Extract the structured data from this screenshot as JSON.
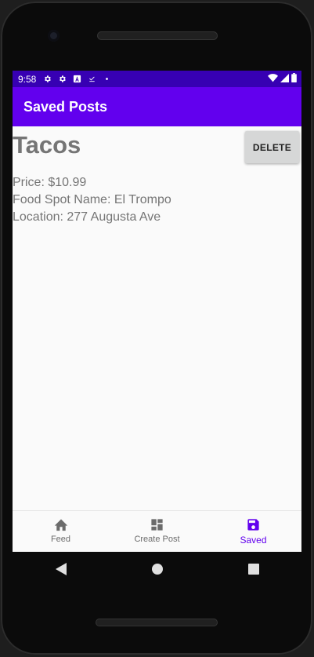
{
  "status": {
    "time": "9:58",
    "icons": [
      "gear-icon",
      "gear-icon",
      "a-icon",
      "download-done-icon",
      "dot-icon"
    ],
    "right_icons": [
      "wifi-icon",
      "signal-icon",
      "battery-icon"
    ]
  },
  "appbar": {
    "title": "Saved Posts"
  },
  "post": {
    "title": "Tacos",
    "delete_label": "DELETE",
    "price": "Price: $10.99",
    "food_spot": "Food Spot Name: El Trompo",
    "location": "Location: 277 Augusta Ave"
  },
  "bottom_nav": {
    "items": [
      {
        "label": "Feed",
        "icon": "home-icon"
      },
      {
        "label": "Create Post",
        "icon": "dashboard-icon"
      },
      {
        "label": "Saved",
        "icon": "save-icon"
      }
    ],
    "active_color": "#6200ee"
  },
  "system_nav": [
    "back-icon",
    "home-circle-icon",
    "recents-icon"
  ],
  "colors": {
    "status_bar": "#3700b3",
    "app_bar": "#6200ee"
  }
}
